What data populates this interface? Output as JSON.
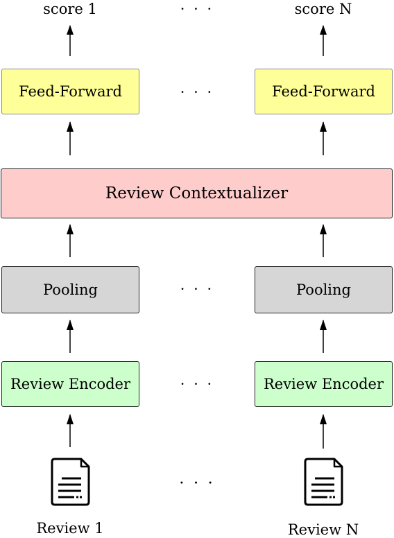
{
  "outputs": {
    "left": "score 1",
    "right": "score N"
  },
  "feed_forward": {
    "left": "Feed-Forward",
    "right": "Feed-Forward"
  },
  "contextualizer": {
    "label": "Review Contextualizer"
  },
  "pooling": {
    "left": "Pooling",
    "right": "Pooling"
  },
  "encoder": {
    "left": "Review Encoder",
    "right": "Review Encoder"
  },
  "inputs": {
    "left": "Review 1",
    "right": "Review N"
  },
  "ellipsis": "· · ·",
  "colors": {
    "feed_forward": "#ffff99",
    "contextualizer": "#ffcccc",
    "pooling": "#d6d6d6",
    "encoder": "#ccffcc"
  }
}
